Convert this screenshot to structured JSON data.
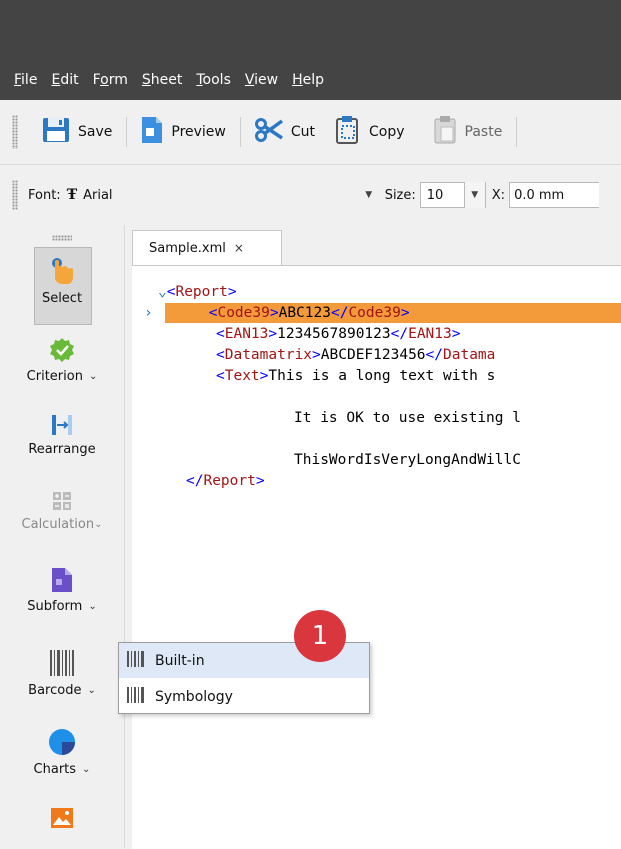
{
  "menu": {
    "items": [
      {
        "underline": "F",
        "rest": "ile"
      },
      {
        "underline": "E",
        "rest": "dit"
      },
      {
        "underline": "F",
        "rest": "o",
        "pre": "",
        "full": "Form"
      },
      {
        "underline": "S",
        "rest": "heet"
      },
      {
        "underline": "T",
        "rest": "ools"
      },
      {
        "underline": "V",
        "rest": "iew"
      },
      {
        "underline": "H",
        "rest": "elp"
      }
    ]
  },
  "toolbar": {
    "save_label": "Save",
    "preview_label": "Preview",
    "cut_label": "Cut",
    "copy_label": "Copy",
    "paste_label": "Paste"
  },
  "fontbar": {
    "font_label": "Font:",
    "font_value": "Arial",
    "size_label": "Size:",
    "size_value": "10",
    "x_label": "X:",
    "x_value": "0.0 mm"
  },
  "tools": {
    "select": "Select",
    "criterion": "Criterion",
    "rearrange": "Rearrange",
    "calculation": "Calculation",
    "subform": "Subform",
    "barcode": "Barcode",
    "charts": "Charts"
  },
  "tab": {
    "title": "Sample.xml",
    "close": "×"
  },
  "code": {
    "report_open": "Report",
    "code39_tag": "Code39",
    "code39_value": "ABC123",
    "ean13_tag": "EAN13",
    "ean13_value": "1234567890123",
    "datamatrix_tag": "Datamatrix",
    "datamatrix_value": "ABCDEF123456",
    "datamatrix_close_partial": "Datama",
    "text_tag": "Text",
    "text_value": "This is a long text with s",
    "line_ok": "It is OK to use existing l",
    "line_long": "ThisWordIsVeryLongAndWillC",
    "report_close": "Report"
  },
  "popup": {
    "items": [
      "Built-in",
      "Symbology"
    ]
  },
  "badge": "1",
  "colors": {
    "titlebar": "#444444",
    "highlight": "#f39a3b",
    "xml_tag": "#a31515",
    "xml_bracket": "#0000ff",
    "badge": "#d9363e"
  }
}
